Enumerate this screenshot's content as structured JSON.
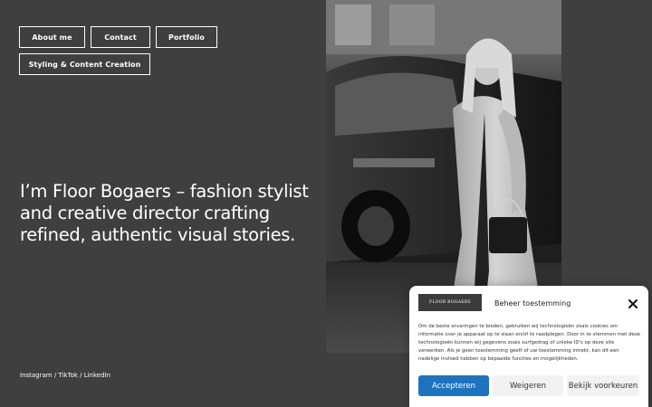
{
  "nav": {
    "about": "About me",
    "contact": "Contact",
    "portfolio": "Portfolio",
    "styling": "Styling & Content Creation"
  },
  "hero": {
    "text": "I’m Floor Bogaers – fashion stylist and creative director crafting refined, authentic visual stories."
  },
  "footer": {
    "social": "Instagram / TikTok / LinkedIn"
  },
  "consent": {
    "logo_text": "FLOOR BOGAERS",
    "title": "Beheer toestemming",
    "body": "Om de beste ervaringen te bieden, gebruiken wij technologieën zoals cookies om informatie over je apparaat op te slaan en/of te raadplegen. Door in te stemmen met deze technologieën kunnen wij gegevens zoals surfgedrag of unieke ID's op deze site verwerken. Als je geen toestemming geeft of uw toestemming intrekt, kan dit een nadelige invloed hebben op bepaalde functies en mogelijkheden.",
    "accept": "Accepteren",
    "deny": "Weigeren",
    "prefs": "Bekijk voorkeuren",
    "accent_color": "#1e73be"
  },
  "photo": {
    "icon": "fashion-photo-woman-coat"
  }
}
